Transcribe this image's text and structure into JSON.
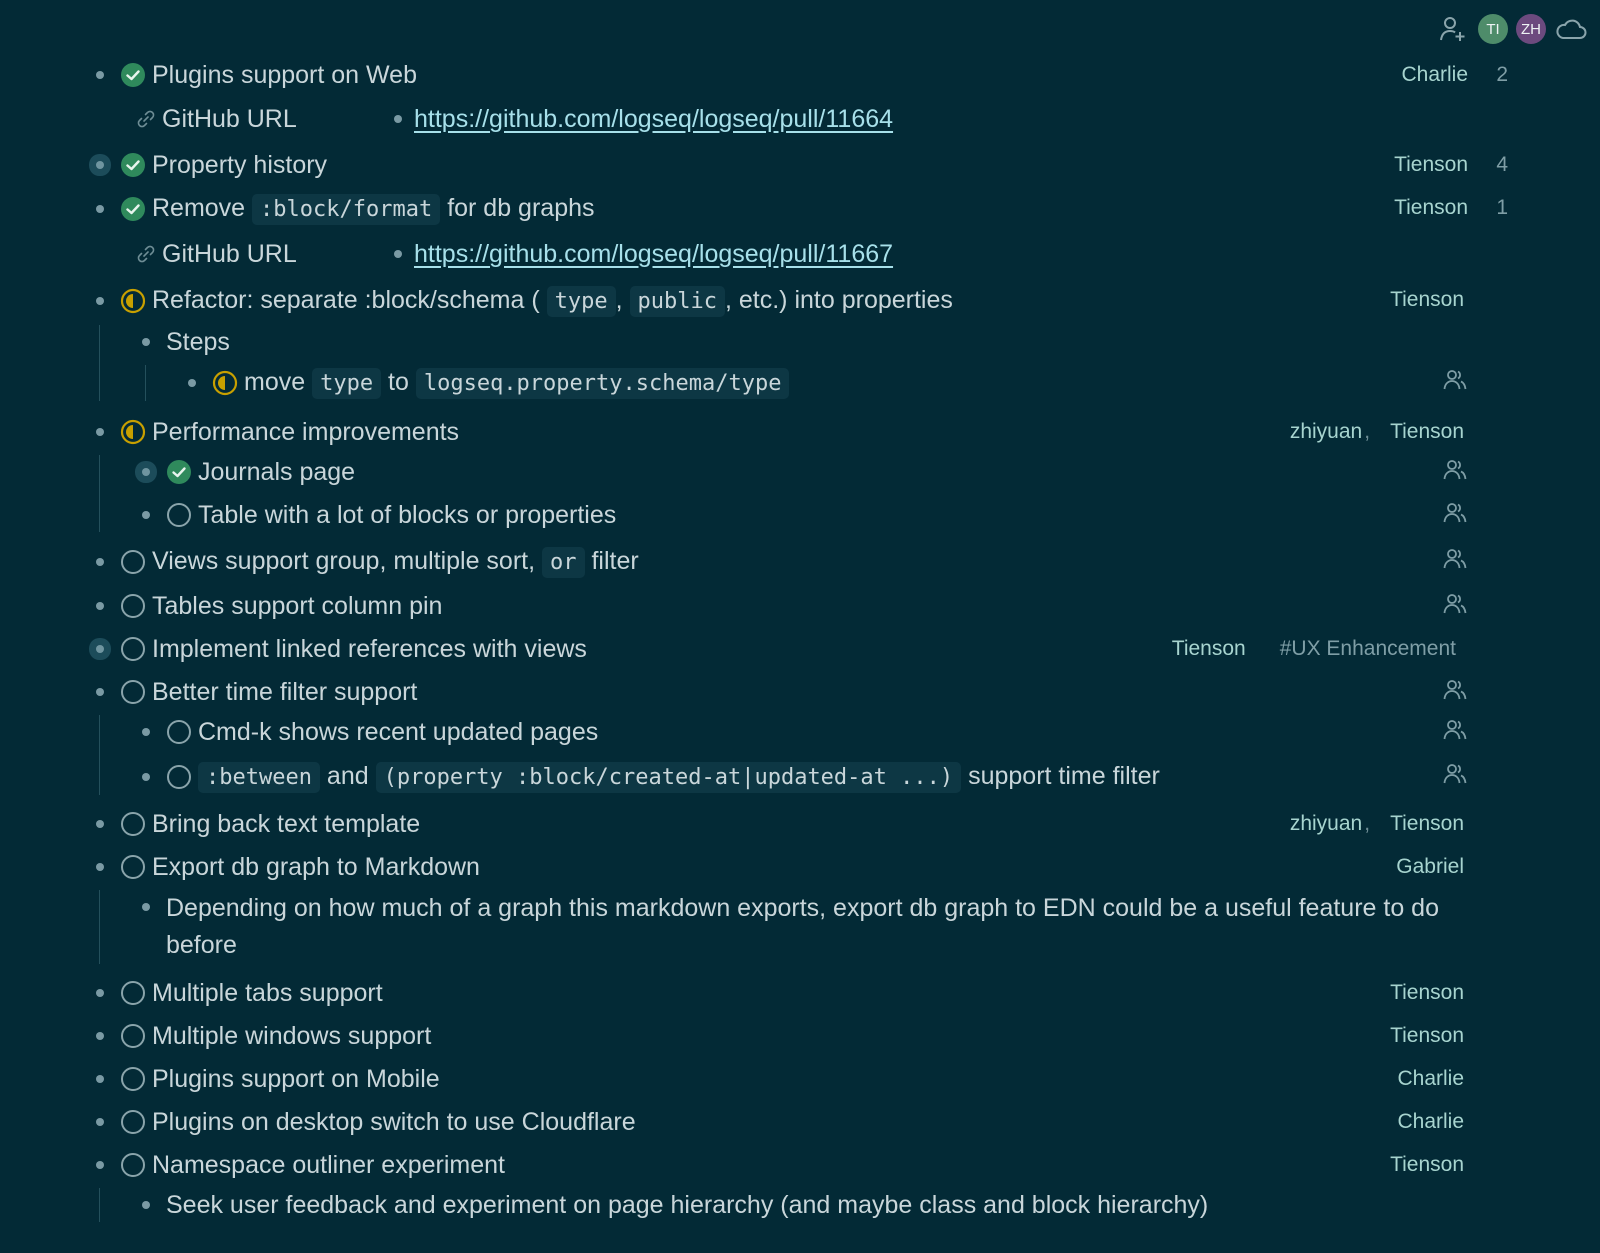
{
  "header": {
    "avatars": [
      {
        "initials": "TI",
        "color": "#4e8c6a"
      },
      {
        "initials": "ZH",
        "color": "#6c4a7e"
      }
    ],
    "icons": [
      "add-user-icon",
      "cloud-sync-icon"
    ]
  },
  "colors": {
    "background": "#032a36",
    "done": "#2f8a5c",
    "doing": "#c8a000",
    "todo": "#8aa4ab",
    "link": "#a7e0ea",
    "assignee": "#a7d4cf"
  },
  "blocks": {
    "b1": {
      "text": "Plugins support on Web",
      "assignee": "Charlie",
      "count": "2",
      "prop_key": "GitHub URL",
      "prop_val": "https://github.com/logseq/logseq/pull/11664"
    },
    "b2": {
      "text": "Property history",
      "assignee": "Tienson",
      "count": "4"
    },
    "b3": {
      "t1": "Remove",
      "code": ":block/format",
      "t2": "for db graphs",
      "assignee": "Tienson",
      "count": "1",
      "prop_key": "GitHub URL",
      "prop_val": "https://github.com/logseq/logseq/pull/11667"
    },
    "b4": {
      "t1": "Refactor: separate :block/schema (",
      "c1": "type",
      "t2": ",",
      "c2": "public",
      "t3": ", etc.) into properties",
      "assignee": "Tienson",
      "steps": "Steps",
      "step1": {
        "t1": "move",
        "c1": "type",
        "t2": "to",
        "c2": "logseq.property.schema/type"
      }
    },
    "b5": {
      "text": "Performance improvements",
      "assignee1": "zhiyuan",
      "sep": ",",
      "assignee2": "Tienson",
      "child1": "Journals page",
      "child2": "Table with a lot of blocks or properties"
    },
    "b6": {
      "t1": "Views support group, multiple sort,",
      "c1": "or",
      "t2": "filter"
    },
    "b7": {
      "text": "Tables support column pin"
    },
    "b8": {
      "text": "Implement linked references with views",
      "assignee": "Tienson",
      "tag": "#UX Enhancement"
    },
    "b9": {
      "text": "Better time filter support",
      "child1": "Cmd-k shows recent updated pages",
      "child2": {
        "c1": ":between",
        "t1": "and",
        "c2": "(property :block/created-at|updated-at ...)",
        "t2": "support time filter"
      }
    },
    "b10": {
      "text": "Bring back text template",
      "assignee1": "zhiyuan",
      "sep": ",",
      "assignee2": "Tienson"
    },
    "b11": {
      "text": "Export db graph to Markdown",
      "assignee": "Gabriel",
      "child": "Depending on how much of a graph this markdown exports, export db graph to EDN could be a useful feature to do before"
    },
    "b12": {
      "text": "Multiple tabs support",
      "assignee": "Tienson"
    },
    "b13": {
      "text": "Multiple windows support",
      "assignee": "Tienson"
    },
    "b14": {
      "text": "Plugins support on Mobile",
      "assignee": "Charlie"
    },
    "b15": {
      "text": "Plugins on desktop switch to use Cloudflare",
      "assignee": "Charlie"
    },
    "b16": {
      "text": "Namespace outliner experiment",
      "assignee": "Tienson",
      "child": "Seek user feedback and experiment on page hierarchy (and maybe class and block hierarchy)"
    }
  }
}
